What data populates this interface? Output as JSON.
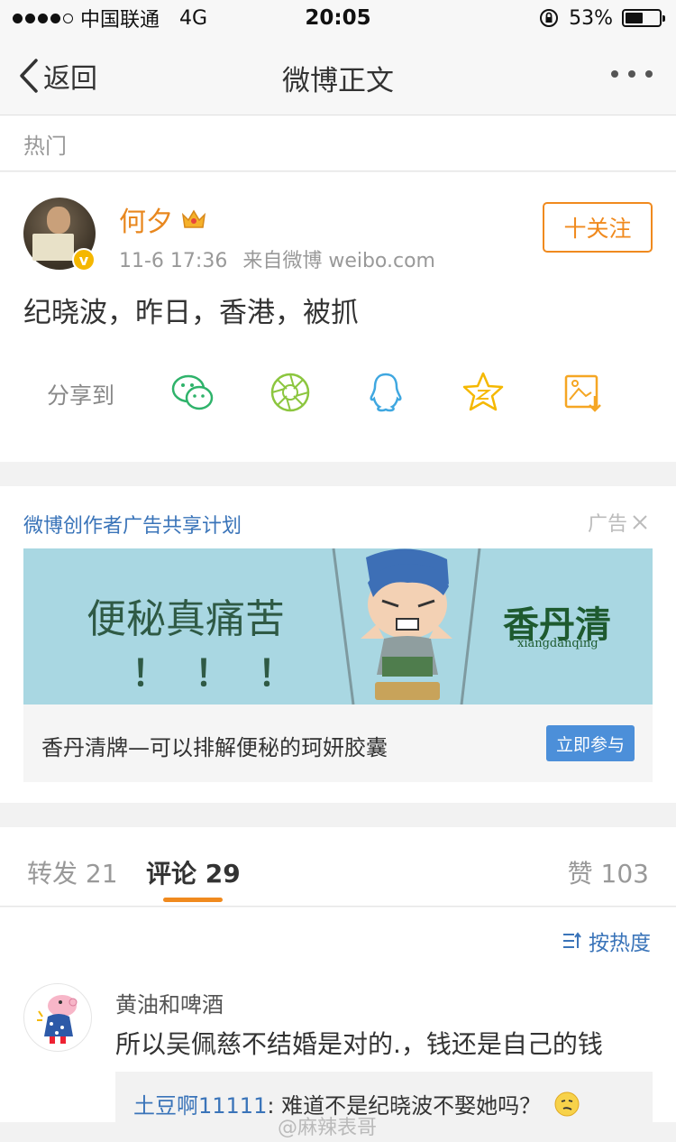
{
  "status_bar": {
    "carrier": "中国联通",
    "network": "4G",
    "time": "20:05",
    "battery": "53%",
    "battery_level": 0.53
  },
  "nav": {
    "back_label": "返回",
    "title": "微博正文"
  },
  "section": {
    "hot_label": "热门"
  },
  "post": {
    "author": "何夕",
    "time": "11-6 17:36",
    "source": "来自微博 weibo.com",
    "follow_label": "十关注",
    "text": "纪晓波，昨日，香港，被抓",
    "share_label": "分享到",
    "share_icons": [
      "wechat-icon",
      "moments-icon",
      "qq-icon",
      "qzone-icon",
      "save-image-icon"
    ]
  },
  "ad": {
    "title": "微博创作者广告共享计划",
    "label": "广告",
    "banner_text": "便秘真痛苦",
    "banner_exclaim": "！！！",
    "brand": "香丹清",
    "brand_pinyin": "xiangdanqing",
    "description": "香丹清牌—可以排解便秘的珂妍胶囊",
    "button": "立即参与"
  },
  "tabs": [
    {
      "label": "转发 21"
    },
    {
      "label": "评论 29"
    },
    {
      "label": "赞 103"
    }
  ],
  "comments": {
    "sort_label": "按热度",
    "items": [
      {
        "user": "黄油和啤酒",
        "text": "所以吴佩慈不结婚是对的.，钱还是自己的钱",
        "reply_user": "土豆啊11111",
        "reply_text": ": 难道不是纪晓波不娶她吗？"
      }
    ]
  },
  "watermark": "@麻辣表哥",
  "colors": {
    "accent": "#f08a1e",
    "link": "#3a74b9",
    "ad_button": "#4c8fd9"
  }
}
